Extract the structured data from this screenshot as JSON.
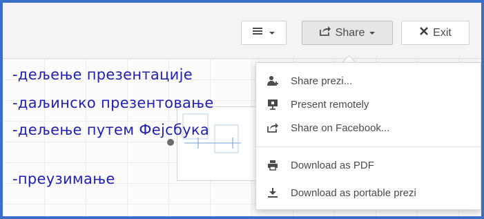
{
  "toolbar": {
    "menu_icon": "hamburger-icon",
    "share_label": "Share",
    "exit_label": "Exit"
  },
  "canvas": {
    "handwritten_lines": [
      "-дељење презентације",
      "-даљинско презентовање",
      "-дељење путем Фејсбука",
      "-преузимање"
    ]
  },
  "share_menu": {
    "items": [
      {
        "label": "Share prezi...",
        "icon": "add-user-icon"
      },
      {
        "label": "Present remotely",
        "icon": "presentation-screen-icon"
      },
      {
        "label": "Share on Facebook...",
        "icon": "share-arrow-icon"
      },
      {
        "label": "Download as PDF",
        "icon": "printer-icon"
      },
      {
        "label": "Download as portable prezi",
        "icon": "download-icon"
      }
    ]
  },
  "colors": {
    "frame_border": "#3a6fc9",
    "handwriting": "#1f1fb3",
    "menu_text": "#4a4a4a"
  }
}
